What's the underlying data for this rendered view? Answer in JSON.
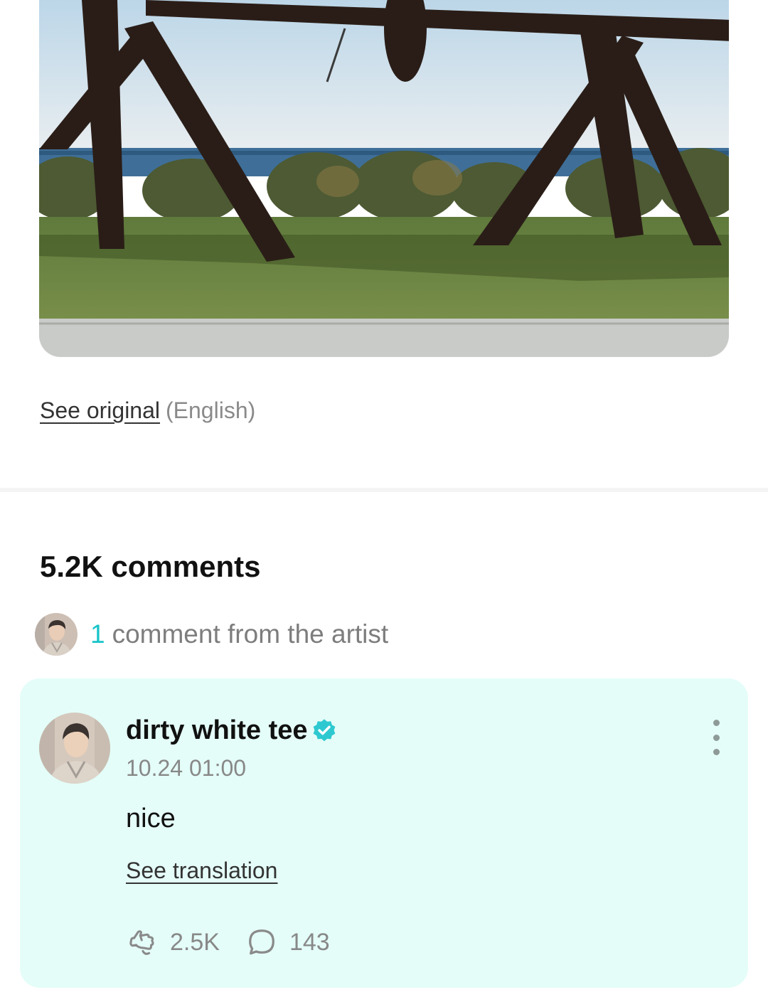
{
  "post": {
    "photo_icon": "sculpture-photo",
    "see_original_label": "See original",
    "original_language": "(English)"
  },
  "comments": {
    "title": "5.2K comments",
    "artist_summary": {
      "count": "1",
      "label": "comment from the artist"
    },
    "artist_comment": {
      "author": "dirty white tee",
      "verified_icon": "verified-badge-icon",
      "timestamp": "10.24 01:00",
      "text": "nice",
      "see_translation_label": "See translation",
      "like_icon": "cheer-hand-icon",
      "like_count": "2.5K",
      "reply_icon": "speech-bubble-icon",
      "reply_count": "143",
      "more_icon": "more-vertical-icon"
    }
  },
  "colors": {
    "accent": "#18c4c8",
    "card_background": "#e4fdf8",
    "muted_text": "#888888"
  }
}
